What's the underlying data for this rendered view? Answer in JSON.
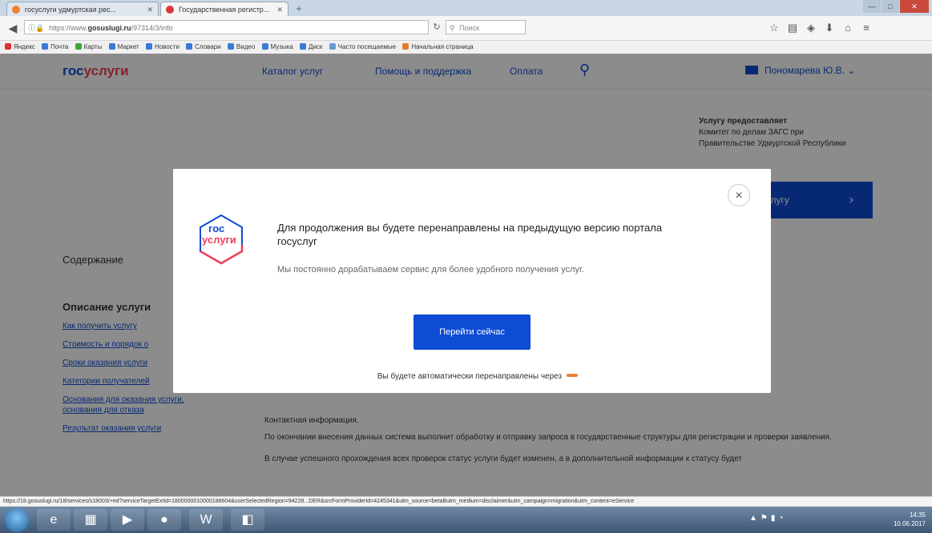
{
  "browser": {
    "tabs": [
      {
        "label": "госуслуги удмуртская рес...",
        "active": false
      },
      {
        "label": "Государственная регистр...",
        "active": true
      }
    ],
    "url_prefix": "https://www.",
    "url_host": "gosuslugi.ru",
    "url_path": "/97314/3/info",
    "search_placeholder": "Поиск",
    "bookmarks": [
      "Яндекс",
      "Почта",
      "Карты",
      "Маркет",
      "Новости",
      "Словари",
      "Видео",
      "Музыка",
      "Диск",
      "Часто посещаемые",
      "Начальная страница"
    ],
    "status_url": "https://18.gosuslugi.ru/18/services/s18003/+ed?serviceTargetExtId=1800000010000188604&userSelectedRegion=94228...DER&srcFormProviderId=4245341&utm_source=betaButm_medium=disclaimer&utm_campaign=migration&utm_content=eService"
  },
  "site": {
    "logo_part1": "гос",
    "logo_part2": "услуги",
    "menu": [
      "Каталог услуг",
      "Помощь и поддержка",
      "Оплата"
    ],
    "user_name": "Пономарева Ю.В.",
    "provider_heading": "Услугу предоставляет",
    "provider_text": "Комитет по делам ЗАГС при Правительстве Удмуртской Республики",
    "get_service_label": "ь услугу",
    "contents_title": "Содержание",
    "description_title": "Описание услуги",
    "side_links": [
      "Как получить услугу",
      "Стоимость и порядок о",
      "Сроки оказания услуги",
      "Категории получателей",
      "Основания для оказания услуги, основания для отказа",
      "Результат оказания услуги"
    ],
    "content_paragraphs": [
      "Контактная информация.",
      "По окончании внесения данных система выполнит обработку и отправку запроса в государственные структуры для регистрации и проверки заявления.",
      "В случае успешного прохождения всех проверок статус услуги будет изменен, а в дополнительной информации к статусу будет"
    ]
  },
  "modal": {
    "logo_line1": "гос",
    "logo_line2": "услуги",
    "title": "Для продолжения вы будете перенаправлены на предыдущую версию портала госуслуг",
    "subtitle": "Мы постоянно дорабатываем сервис для более удобного получения услуг.",
    "button_label": "Перейти сейчас",
    "auto_text": "Вы будете автоматически перенаправлены через",
    "close_label": "×"
  },
  "taskbar": {
    "time": "14:35",
    "date": "10.06.2017"
  },
  "colors": {
    "brand_blue": "#0d4cd3",
    "brand_red": "#ee3f58",
    "spinner": "#f08030"
  },
  "icons": [
    "search-icon",
    "close-icon",
    "envelope-icon",
    "chevron-right-icon",
    "back-icon",
    "star-icon",
    "home-icon",
    "menu-icon"
  ]
}
